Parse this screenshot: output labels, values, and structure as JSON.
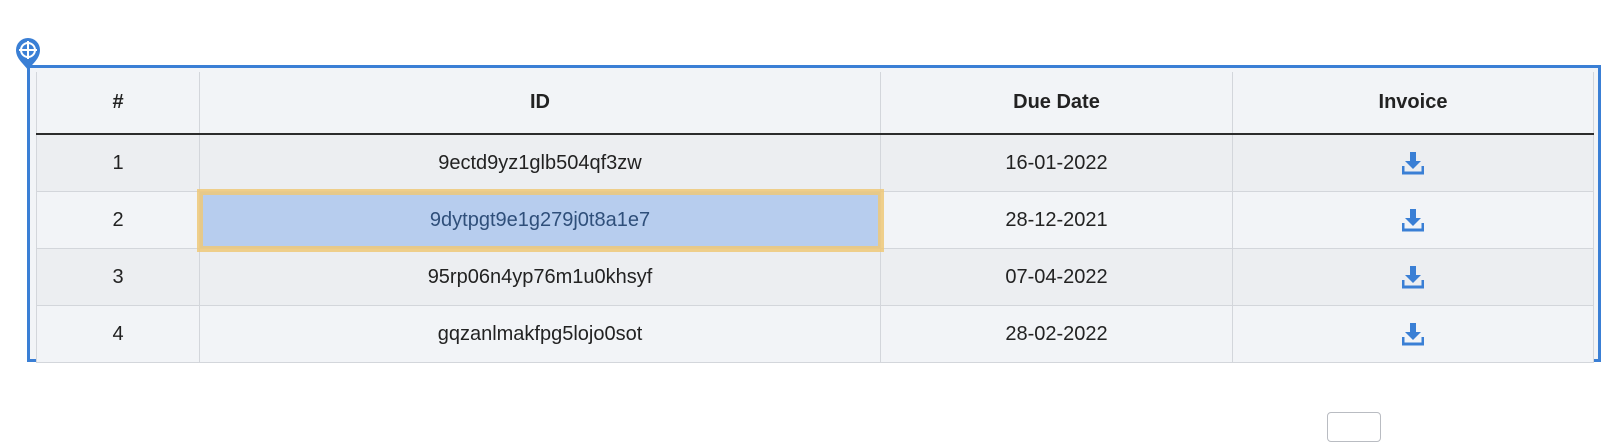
{
  "table": {
    "headers": [
      "#",
      "ID",
      "Due Date",
      "Invoice"
    ],
    "rows": [
      {
        "num": "1",
        "id": "9ectd9yz1glb504qf3zw",
        "due_date": "16-01-2022",
        "invoice_icon": "download-icon"
      },
      {
        "num": "2",
        "id": "9dytpgt9e1g279j0t8a1e7",
        "due_date": "28-12-2021",
        "invoice_icon": "download-icon"
      },
      {
        "num": "3",
        "id": "95rp06n4yp76m1u0khsyf",
        "due_date": "07-04-2022",
        "invoice_icon": "download-icon"
      },
      {
        "num": "4",
        "id": "gqzanlmakfpg5lojo0sot",
        "due_date": "28-02-2022",
        "invoice_icon": "download-icon"
      }
    ],
    "highlighted_row": 2
  },
  "colors": {
    "frame_border": "#3a7fd5",
    "highlight_fill": "#b7cdee",
    "highlight_outline": "#efc878",
    "icon_blue": "#3a7fd5"
  },
  "icons": {
    "locator": "crosshair-pin-icon",
    "download": "download-icon"
  }
}
